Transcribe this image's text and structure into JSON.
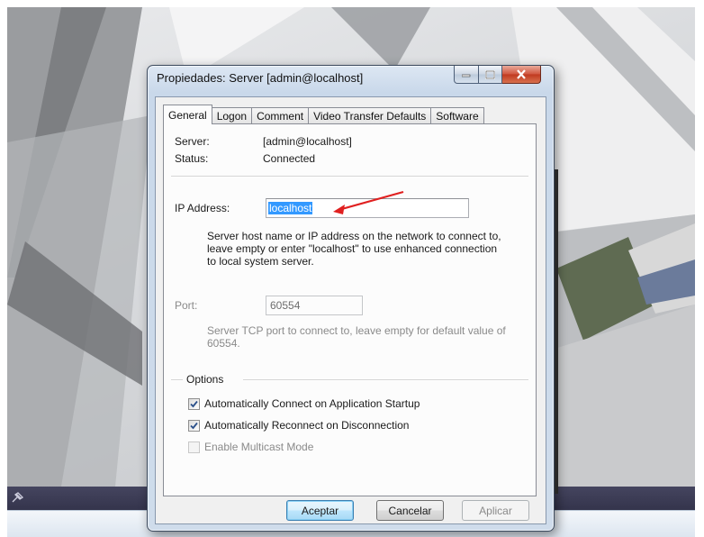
{
  "window": {
    "title": "Propiedades: Server [admin@localhost]"
  },
  "tabs": [
    {
      "label": "General",
      "active": true
    },
    {
      "label": "Logon",
      "active": false
    },
    {
      "label": "Comment",
      "active": false
    },
    {
      "label": "Video Transfer Defaults",
      "active": false
    },
    {
      "label": "Software",
      "active": false
    }
  ],
  "info": {
    "server_label": "Server:",
    "server_value": "[admin@localhost]",
    "status_label": "Status:",
    "status_value": "Connected"
  },
  "ip": {
    "label": "IP Address:",
    "value": "localhost",
    "description": "Server host name or IP address on the network to connect to,\nleave empty or enter \"localhost\" to use enhanced connection\nto local system server."
  },
  "port": {
    "label": "Port:",
    "value": "60554",
    "description": "Server TCP port to connect to, leave empty for default value of\n60554."
  },
  "options": {
    "title": "Options",
    "items": [
      {
        "label": "Automatically Connect on Application Startup",
        "checked": true,
        "enabled": true
      },
      {
        "label": "Automatically Reconnect on Disconnection",
        "checked": true,
        "enabled": true
      },
      {
        "label": "Enable Multicast Mode",
        "checked": false,
        "enabled": false
      }
    ]
  },
  "buttons": {
    "ok": "Aceptar",
    "cancel": "Cancelar",
    "apply": "Aplicar"
  },
  "icons": {
    "window_controls": [
      "minimize-icon",
      "maximize-icon",
      "close-icon"
    ],
    "annotation": "red-arrow-icon",
    "background_pin": "pin-icon"
  },
  "colors": {
    "selection": "#3399ff",
    "annotation_arrow": "#e02020",
    "close_button": "#c0391f"
  }
}
